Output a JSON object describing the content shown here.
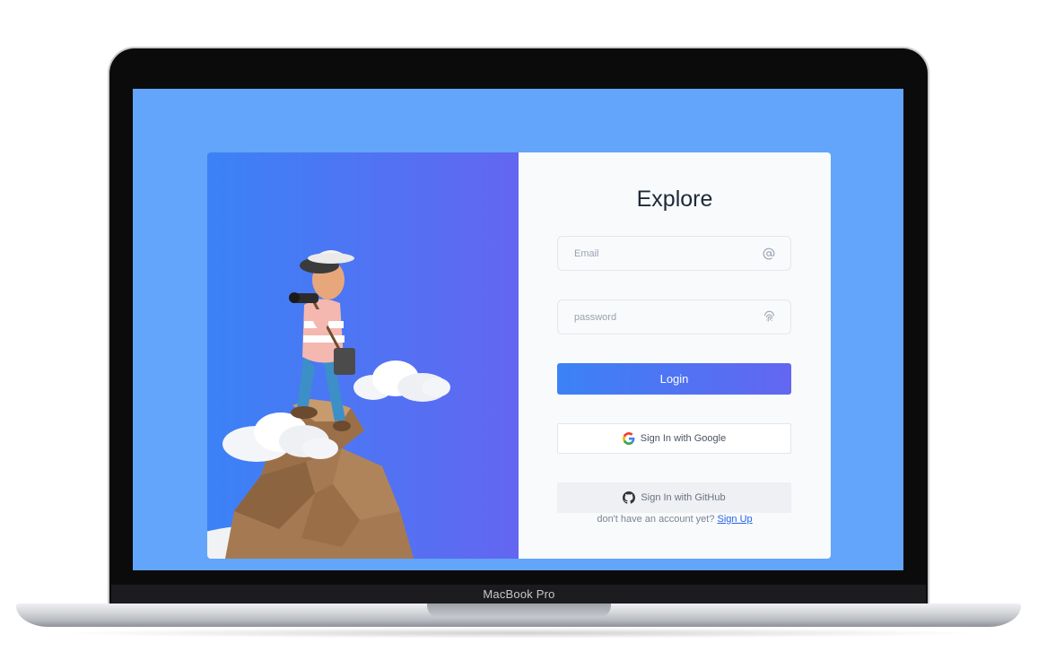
{
  "device": {
    "brand_label": "MacBook Pro"
  },
  "colors": {
    "screen_background": "#62a5fa",
    "gradient_start": "#3b82f6",
    "gradient_end": "#6366f1",
    "form_background": "#f8fafc",
    "link": "#2563eb"
  },
  "hero": {
    "illustration": "explorer-on-mountain-with-binoculars"
  },
  "login_form": {
    "title": "Explore",
    "email": {
      "placeholder": "Email",
      "value": "",
      "icon": "at-sign-icon"
    },
    "password": {
      "placeholder": "password",
      "value": "",
      "icon": "fingerprint-icon"
    },
    "login_label": "Login",
    "google_label": "Sign In with Google",
    "github_label": "Sign In with GitHub",
    "signup_prompt": "don't have an account yet?",
    "signup_link": "Sign Up"
  }
}
